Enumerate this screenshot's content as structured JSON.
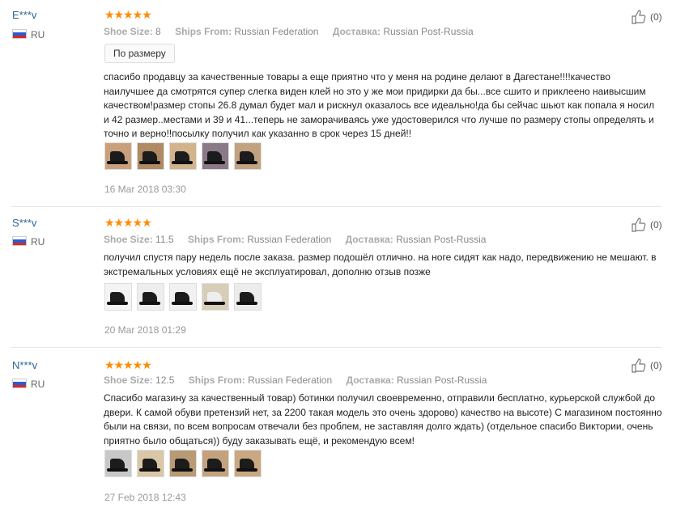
{
  "reviews": [
    {
      "user": "E***v",
      "country": "RU",
      "stars": "★★★★★",
      "shoe_size_label": "Shoe Size:",
      "shoe_size": "8",
      "ships_from_label": "Ships From:",
      "ships_from": "Russian Federation",
      "delivery_label": "Доставка:",
      "delivery": "Russian Post-Russia",
      "tag": "По размеру",
      "text": "спасибо продавцу за качественные товары а еще приятно что у меня на родине делают в Дагестане!!!!качество наилучшее да смотрятся супер слегка виден клей но это у же мои придирки да бы...все сшито и приклеено наивысшим качеством!размер стопы 26.8 думал будет мал и рискнул оказалось все идеально!да бы сейчас шьют как попала я носил и 42 размер..местами и 39 и 41...теперь не заморачиваясь уже удостоверился что лучше по размеру стопы определять и точно и верно!!посылку получил как указанно в срок через 15 дней!!",
      "date": "16 Mar 2018 03:30",
      "likes": "(0)"
    },
    {
      "user": "S***v",
      "country": "RU",
      "stars": "★★★★★",
      "shoe_size_label": "Shoe Size:",
      "shoe_size": "11.5",
      "ships_from_label": "Ships From:",
      "ships_from": "Russian Federation",
      "delivery_label": "Доставка:",
      "delivery": "Russian Post-Russia",
      "text": "получил спустя пару недель после заказа. размер подошёл отлично. на ноге сидят как надо, передвижению не мешают. в экстремальных условиях ещё не эксплуатировал, дополню отзыв позже",
      "date": "20 Mar 2018 01:29",
      "likes": "(0)"
    },
    {
      "user": "N***v",
      "country": "RU",
      "stars": "★★★★★",
      "shoe_size_label": "Shoe Size:",
      "shoe_size": "12.5",
      "ships_from_label": "Ships From:",
      "ships_from": "Russian Federation",
      "delivery_label": "Доставка:",
      "delivery": "Russian Post-Russia",
      "text": "Спасибо магазину за качественный товар) ботинки получил своевременно, отправили бесплатно, курьерской службой до двери. К самой обуви претензий нет, за 2200 такая модель это очень здорово) качество на высоте) С магазином постоянно были на связи, по всем вопросам отвечали без проблем, не заставляя долго ждать) (отдельное спасибо Виктории, очень приятно было общаться)) буду заказывать ещё, и рекомендую всем!",
      "date": "27 Feb 2018 12:43",
      "likes": "(0)"
    }
  ],
  "colors": {
    "star": "#ff8c00",
    "username": "#2a6496"
  },
  "icons": {
    "like": "thumbs-up-icon",
    "flag": "russia-flag-icon"
  }
}
